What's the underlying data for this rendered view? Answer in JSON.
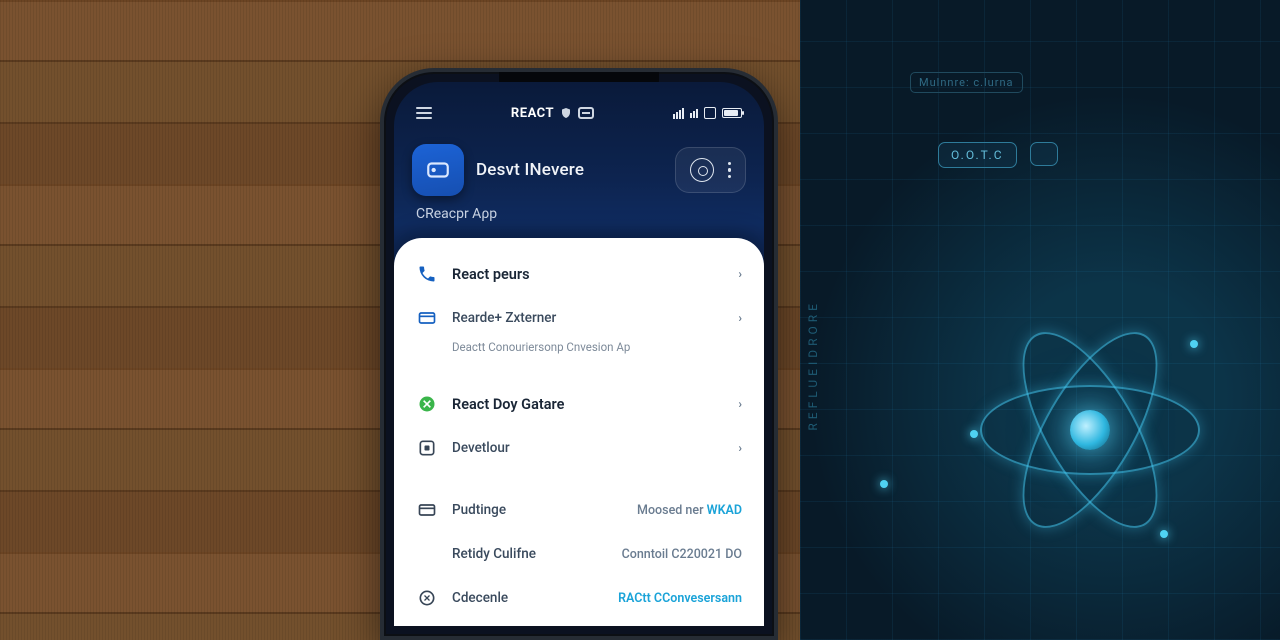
{
  "status": {
    "brand": "REACT"
  },
  "header": {
    "title": "Desvt INevere",
    "subtitle": "CReacpr Aρp"
  },
  "list": {
    "group1": [
      {
        "icon": "phone",
        "label": "React peurs"
      },
      {
        "icon": "card",
        "label": "Rearde+ Zxterner"
      }
    ],
    "group1_desc": "Deactt Conouriersonp Cnvesion Ap",
    "group2": [
      {
        "icon": "green",
        "label": "React Doy Gatare"
      },
      {
        "icon": "box",
        "label": "Devetlour"
      }
    ],
    "group3": [
      {
        "icon": "card2",
        "label": "Pudtinge",
        "right_a": "Moosed ner",
        "right_b": "WKAD"
      },
      {
        "icon": "none",
        "label": "Retidy Culifne",
        "right_a": "Conntoil C220021 DO",
        "right_b": ""
      },
      {
        "icon": "sync",
        "label": "Cdecenle",
        "right_a": "",
        "right_b": "RACtt CConvesersann"
      }
    ]
  },
  "tech": {
    "chip_label": "O.O.T.C",
    "top_label": "Mulnnre: c.lurna",
    "side_label": "REFLUEIDRORE"
  }
}
